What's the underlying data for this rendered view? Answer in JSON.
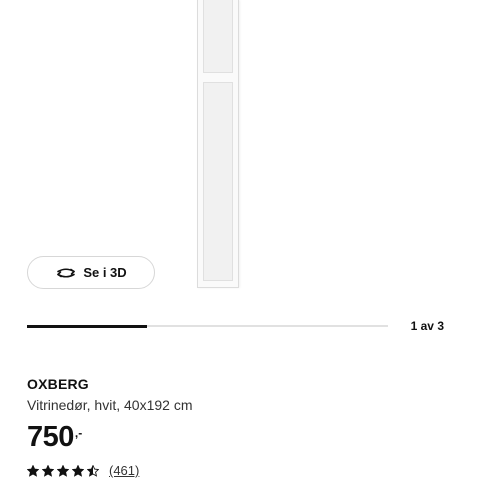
{
  "view3d": {
    "label": "Se i 3D",
    "icon": "rotate-3d-icon"
  },
  "carousel": {
    "current": 1,
    "total": 3,
    "indicator": "1 av 3",
    "progress": 0.333
  },
  "product": {
    "name": "OXBERG",
    "description": "Vitrinedør, hvit, 40x192 cm",
    "price_integer": "750",
    "price_suffix": ",-",
    "rating": 4.5,
    "rating_max": 5,
    "review_count": "(461)"
  },
  "colors": {
    "text": "#111111",
    "track": "#e1e1e1",
    "accent": "#111111"
  }
}
